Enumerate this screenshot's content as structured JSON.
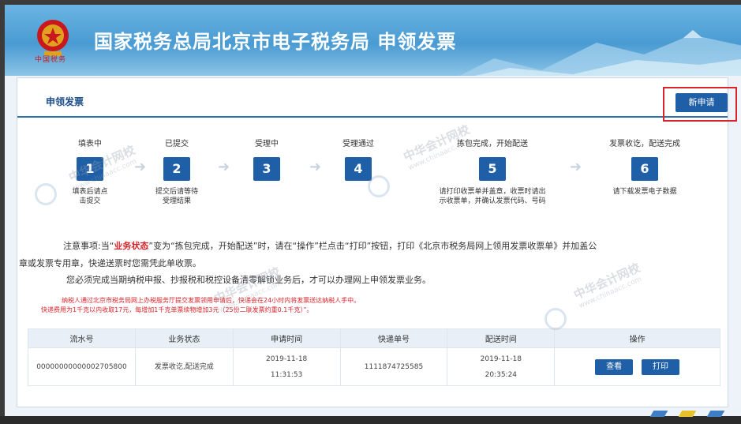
{
  "header": {
    "title": "国家税务总局北京市电子税务局  申领发票",
    "emblem_text": "中国税务"
  },
  "panel": {
    "title": "申领发票",
    "new_button": "新申请"
  },
  "steps": [
    {
      "num": "1",
      "label": "填表中",
      "desc": "填表后请点\n击提交"
    },
    {
      "num": "2",
      "label": "已提交",
      "desc": "提交后请等待\n受理结果"
    },
    {
      "num": "3",
      "label": "受理中",
      "desc": ""
    },
    {
      "num": "4",
      "label": "受理通过",
      "desc": ""
    },
    {
      "num": "5",
      "label": "拣包完成，开始配送",
      "desc": "请打印收票单并盖章，收票时请出\n示收票单，并确认发票代码、号码"
    },
    {
      "num": "6",
      "label": "发票收讫，配送完成",
      "desc": "请下载发票电子数据"
    }
  ],
  "notice": {
    "line1_pre": "注意事项:当“",
    "line1_red": "业务状态",
    "line1_post": "”变为“拣包完成，开始配送”时，请在“操作”栏点击“打印”按钮，打印《北京市税务局网上领用发票收票单》并加盖公",
    "line1_cont": "章或发票专用章，快递送票时您需凭此单收票。",
    "line2": "您必须完成当期纳税申报、抄报税和税控设备清零解锁业务后，才可以办理网上申领发票业务。",
    "red1": "纳税人通过北京市税务局网上办税服务厅提交发票领用申请后，快递会在24小时内将发票送达纳税人手中。",
    "red2": "快递费用为1千克以内收取17元，每增加1千克单票续物增加3元（25份二联发票约重0.1千克）”。"
  },
  "table": {
    "headers": [
      "流水号",
      "业务状态",
      "申请时间",
      "快递单号",
      "配送时间",
      "操作"
    ],
    "rows": [
      {
        "serial": "00000000000002705800",
        "status": "发票收讫,配送完成",
        "apply_date": "2019-11-18",
        "apply_time": "11:31:53",
        "tracking": "1111874725585",
        "ship_date": "2019-11-18",
        "ship_time": "20:35:24",
        "view_label": "查看",
        "print_label": "打印"
      }
    ]
  },
  "watermark": {
    "text": "中华会计网校",
    "url": "www.chinaacc.com"
  },
  "colors": {
    "accent": "#1e5fa8",
    "alert": "#d9242b",
    "banner": "#4a9bd3"
  }
}
